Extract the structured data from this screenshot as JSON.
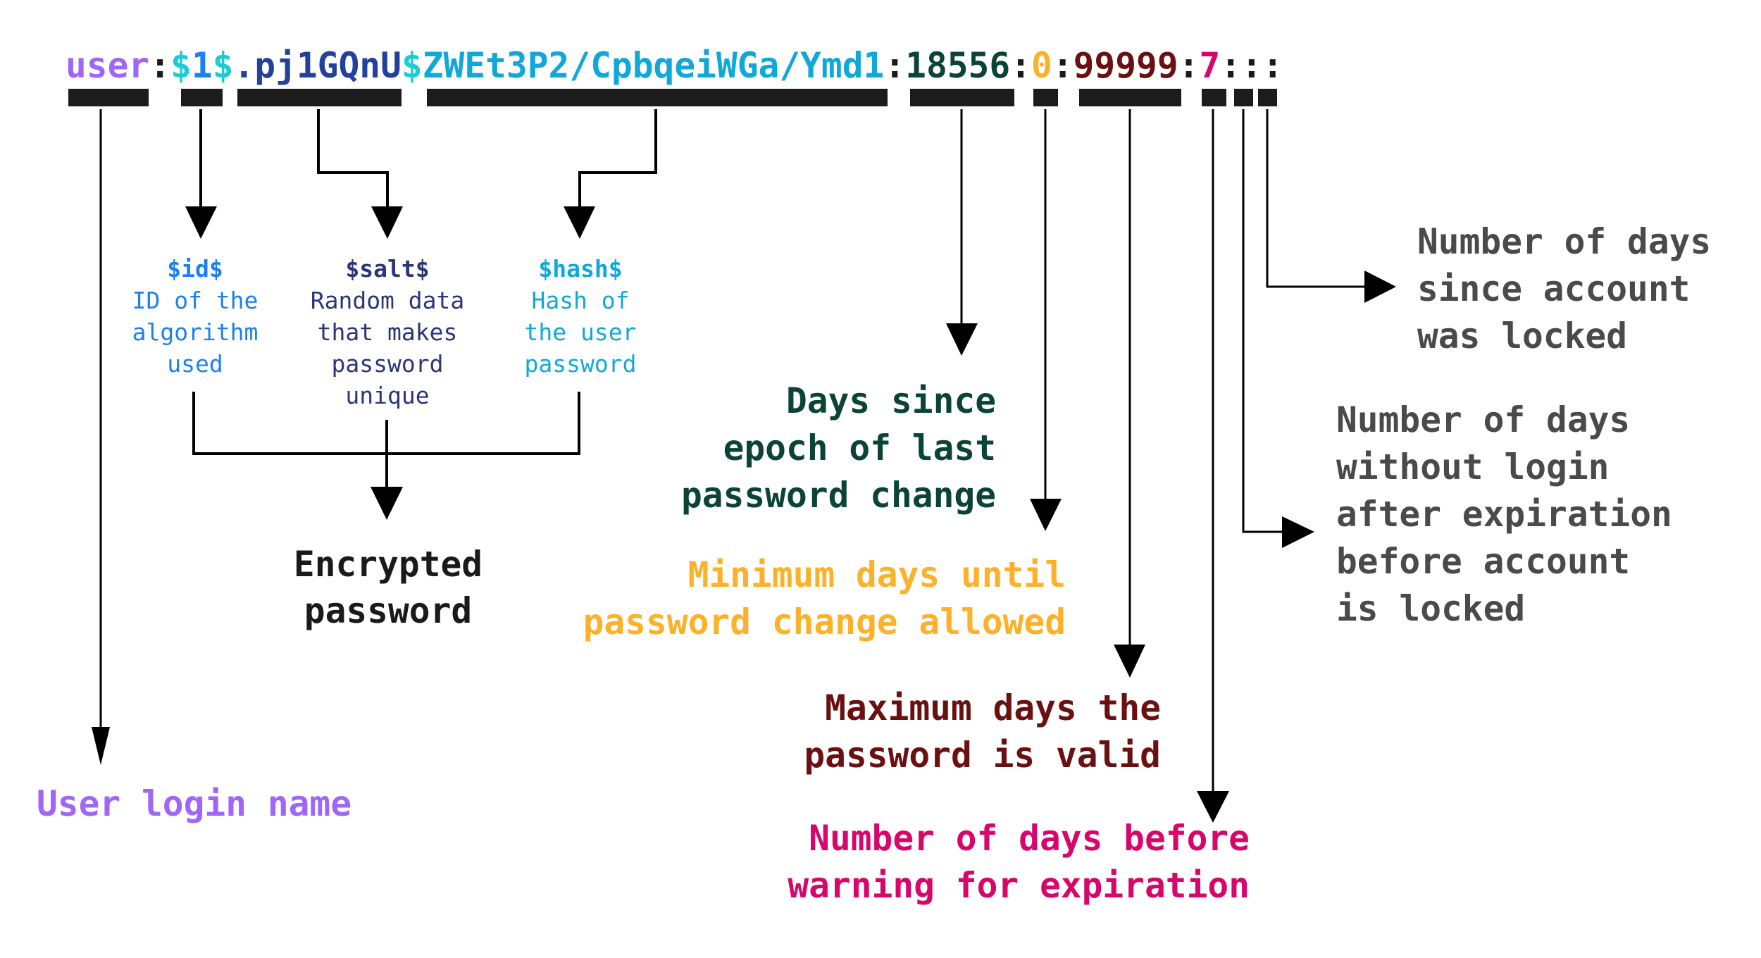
{
  "colors": {
    "user": "#a066f5",
    "id_dollar": "#1ccbd6",
    "id": "#1e80f0",
    "salt": "#22419a",
    "hash": "#10a8d8",
    "separator": "#1a1a1a",
    "last_change": "#0b4435",
    "min_days": "#fbb12a",
    "max_days": "#6b1010",
    "warn_days": "#d6066a",
    "gray": "#4a4a4a",
    "encrypted": "#1a1a1a"
  },
  "shadow_line": {
    "user": "user",
    "sep1": ":",
    "dollar_a": "$",
    "id": "1",
    "dollar_b": "$",
    "salt": ".pj1GQnU",
    "dollar_c": "$",
    "hash": "ZWEt3P2/CpbqeiWGa/Ymd1",
    "sep2": ":",
    "last_change": "18556",
    "sep3": ":",
    "min_days": "0",
    "sep4": ":",
    "max_days": "99999",
    "sep5": ":",
    "warn_days": "7",
    "trailing": ":::"
  },
  "components": {
    "id": {
      "title": "$id$",
      "lines": [
        "ID of the",
        "algorithm",
        "used"
      ]
    },
    "salt": {
      "title": "$salt$",
      "lines": [
        "Random data",
        "that makes",
        "password",
        "unique"
      ]
    },
    "hash": {
      "title": "$hash$",
      "lines": [
        "Hash of",
        "the user",
        "password"
      ]
    }
  },
  "labels": {
    "encrypted_password": [
      "Encrypted",
      "password"
    ],
    "user_login_name": "User login name",
    "last_change": [
      "Days since",
      "epoch of last",
      "password change"
    ],
    "min_days": [
      "Minimum days until",
      "password change allowed"
    ],
    "max_days": [
      "Maximum days the",
      "password is valid"
    ],
    "warn_days": [
      "Number of days before",
      "warning for expiration"
    ],
    "inactive_days": [
      "Number of days",
      "without login",
      "after expiration",
      "before account",
      "is locked"
    ],
    "expire_days": [
      "Number of days",
      "since account",
      "was locked"
    ]
  }
}
